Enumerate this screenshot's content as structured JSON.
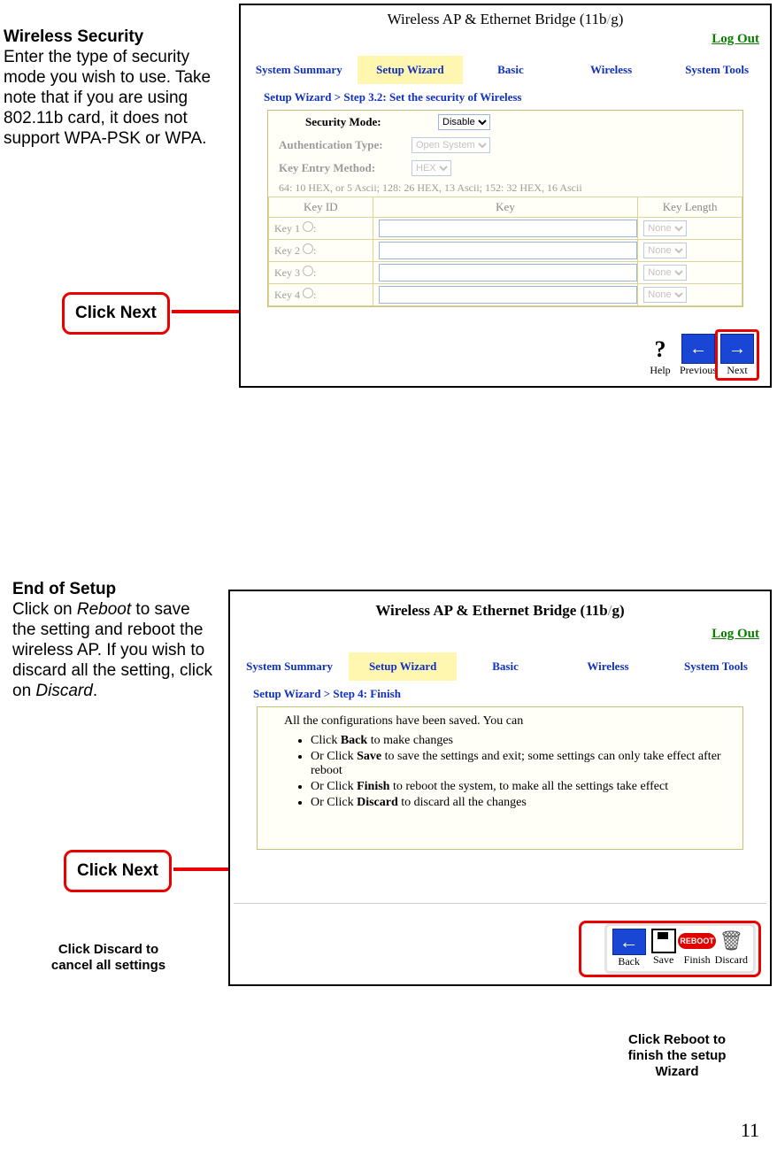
{
  "page_number": "11",
  "side1": {
    "heading": "Wireless Security",
    "body": "Enter the type of security mode you wish to use. Take note that if you are using 802.11b card, it does not support WPA-PSK or WPA."
  },
  "callout1": "Click Next",
  "side2": {
    "heading": "End of Setup",
    "body_before_reboot": "Click on ",
    "reboot_word": "Reboot",
    "body_mid": " to save the setting and reboot the wireless AP. If you wish to discard all the setting, click on ",
    "discard_word": "Discard",
    "body_after": "."
  },
  "callout2": "Click Next",
  "hint_discard": "Click Discard to cancel all settings",
  "hint_reboot": "Click Reboot to finish the setup Wizard",
  "router": {
    "title": "Wireless AP & Ethernet Bridge (11b/g)",
    "logout": "Log Out",
    "nav": {
      "system_summary": "System Summary",
      "setup_wizard": "Setup Wizard",
      "basic": "Basic",
      "wireless": "Wireless",
      "system_tools": "System Tools"
    }
  },
  "shot1": {
    "breadcrumb": "Setup Wizard > Step 3.2: Set the security of Wireless",
    "security_mode_label": "Security Mode:",
    "security_mode_value": "Disable",
    "auth_type_label": "Authentication Type:",
    "auth_type_value": "Open System",
    "key_entry_label": "Key Entry Method:",
    "key_entry_value": "HEX",
    "hint_line": "64: 10 HEX, or 5 Ascii; 128: 26 HEX, 13 Ascii; 152: 32 HEX, 16 Ascii",
    "col_keyid": "Key ID",
    "col_key": "Key",
    "col_keylen": "Key Length",
    "rows": [
      {
        "label": "Key 1",
        "len": "None"
      },
      {
        "label": "Key 2",
        "len": "None"
      },
      {
        "label": "Key 3",
        "len": "None"
      },
      {
        "label": "Key 4",
        "len": "None"
      }
    ],
    "btn_help": "Help",
    "btn_prev": "Previous",
    "btn_next": "Next"
  },
  "shot2": {
    "breadcrumb": "Setup Wizard > Step 4: Finish",
    "msg": "All the configurations have been saved. You can",
    "li1a": "Click ",
    "li1b": "Back",
    "li1c": " to make changes",
    "li2a": "Or Click ",
    "li2b": "Save",
    "li2c": " to save the settings and exit; some settings can only take effect after reboot",
    "li3a": "Or Click ",
    "li3b": "Finish",
    "li3c": " to reboot the system, to make all the settings take effect",
    "li4a": "Or Click ",
    "li4b": "Discard",
    "li4c": " to discard all the changes",
    "btn_back": "Back",
    "btn_save": "Save",
    "btn_finish": "Finish",
    "btn_discard": "Discard"
  }
}
